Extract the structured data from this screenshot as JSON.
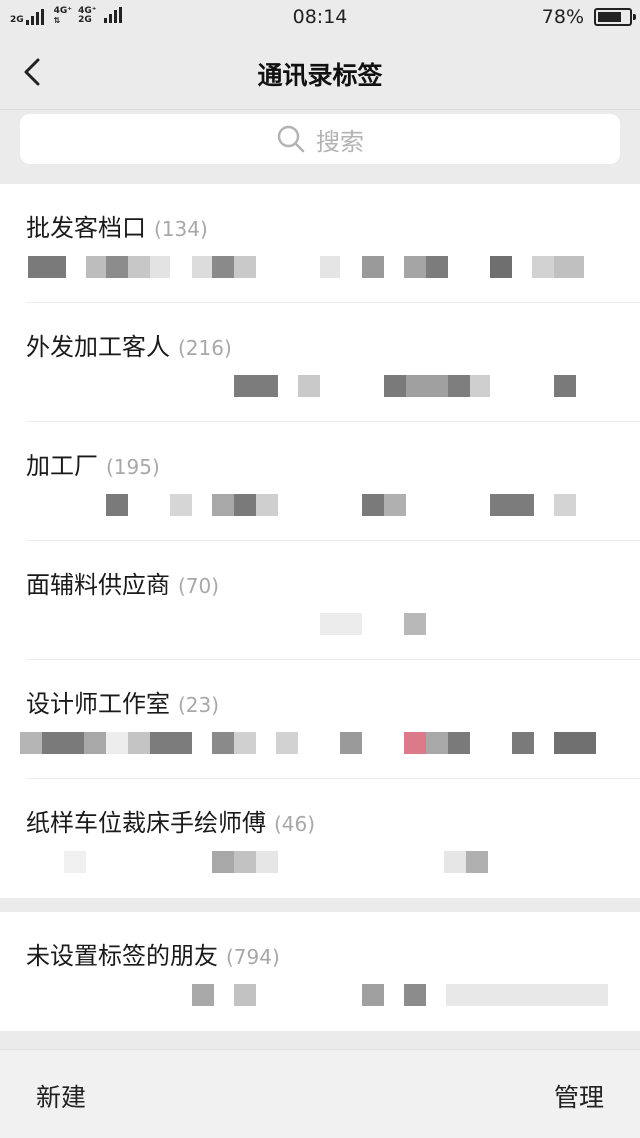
{
  "status_bar": {
    "network_1": "2G",
    "network_2": "4G⁺",
    "network_3": "4G⁺",
    "network_4": "2G",
    "time": "08:14",
    "battery_percent": "78%",
    "battery_level": 0.78
  },
  "nav": {
    "title": "通讯录标签",
    "back_icon": "chevron-left-icon"
  },
  "search": {
    "placeholder": "搜索",
    "icon": "search-icon"
  },
  "tags": [
    {
      "name": "批发客档口",
      "count": "(134)"
    },
    {
      "name": "外发加工客人",
      "count": "(216)"
    },
    {
      "name": "加工厂",
      "count": "(195)"
    },
    {
      "name": "面辅料供应商",
      "count": "(70)"
    },
    {
      "name": "设计师工作室",
      "count": "(23)"
    },
    {
      "name": "纸样车位裁床手绘师傅",
      "count": "(46)"
    }
  ],
  "untagged": {
    "name": "未设置标签的朋友",
    "count": "(794)"
  },
  "toolbar": {
    "new_label": "新建",
    "manage_label": "管理"
  },
  "colors": {
    "background": "#ebebeb",
    "card": "#ffffff",
    "count_gray": "#a8a8a8",
    "placeholder_gray": "#b3b3b3"
  }
}
